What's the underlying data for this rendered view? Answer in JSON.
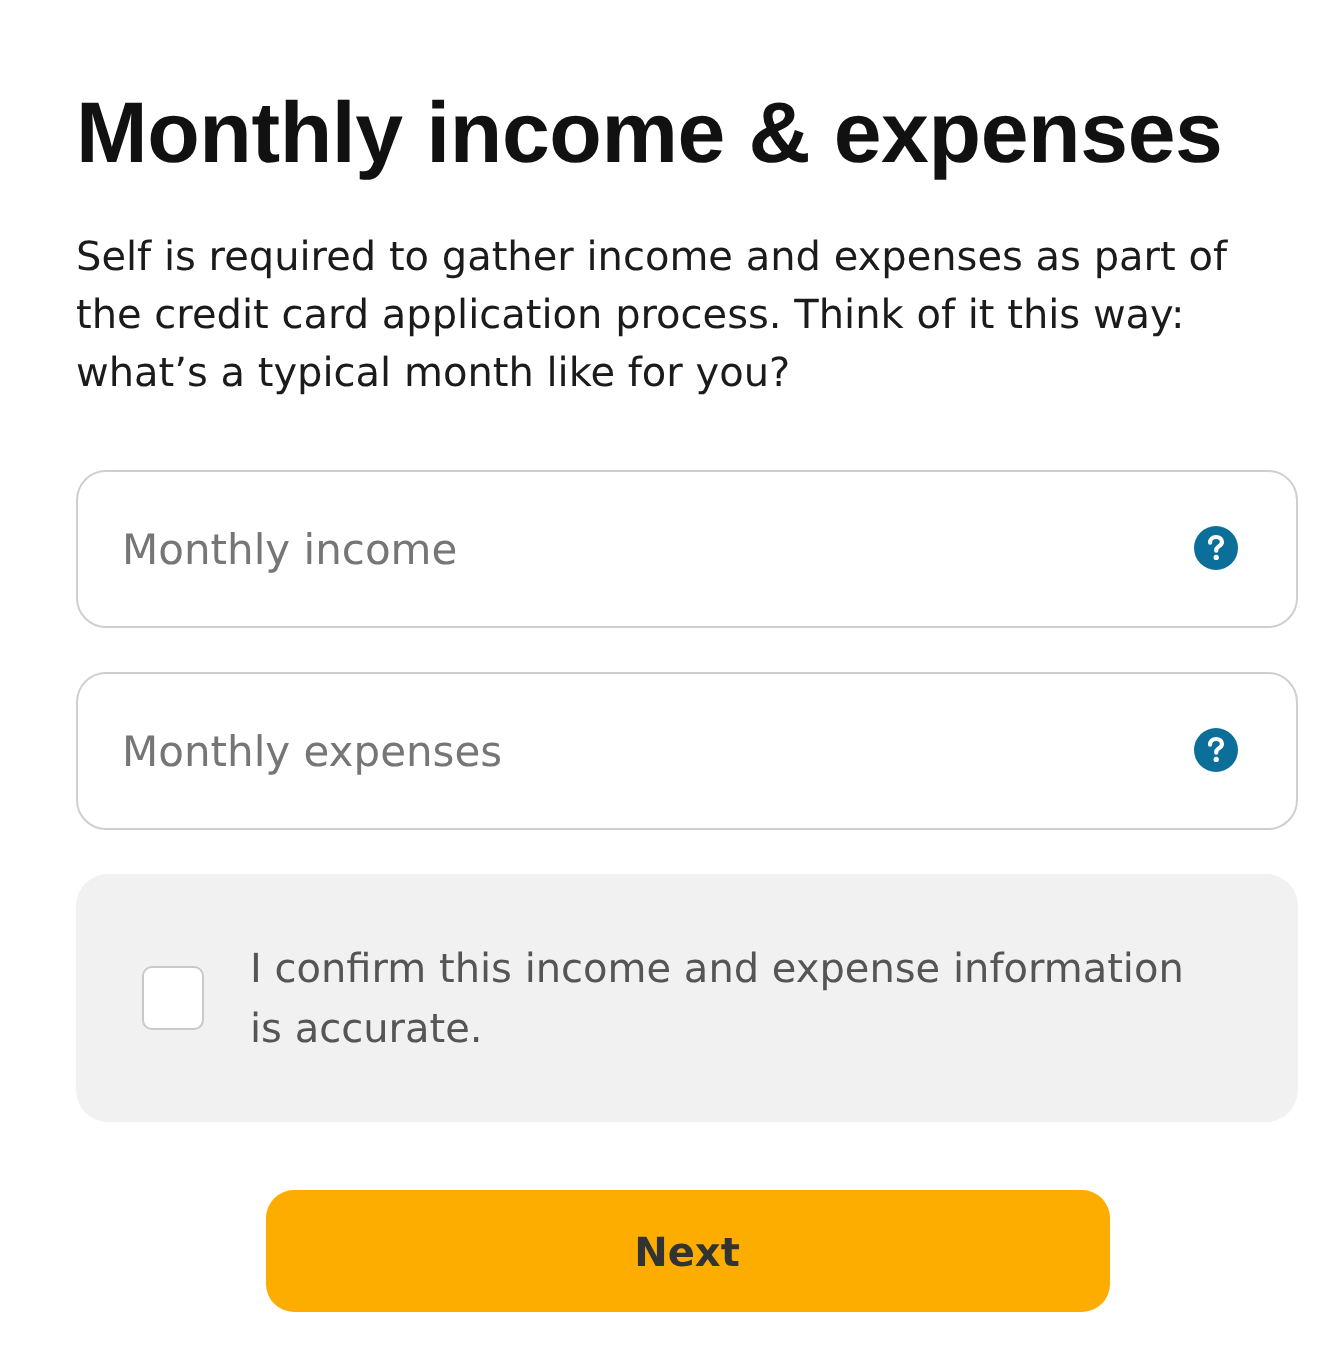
{
  "title": "Monthly income & expenses",
  "intro": "Self is required to gather income and expenses as part of the credit card application process. Think of it this way: what’s a typical month like for you?",
  "fields": [
    {
      "placeholder": "Monthly income"
    },
    {
      "placeholder": "Monthly expenses"
    }
  ],
  "confirmation": {
    "label": "I confirm this income and expense information is accurate.",
    "checked": false
  },
  "next_button": {
    "label": "Next"
  }
}
